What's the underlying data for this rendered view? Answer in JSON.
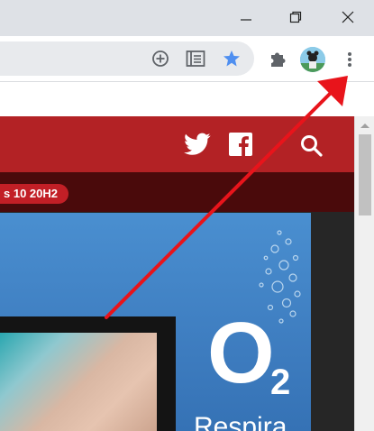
{
  "window": {
    "minimize_icon": "minimize-icon",
    "restore_icon": "restore-icon",
    "close_icon": "close-icon"
  },
  "toolbar": {
    "icons": [
      "add-circle-icon",
      "reading-list-icon",
      "star-icon",
      "puzzle-extensions-icon",
      "avatar",
      "kebab-menu-icon"
    ],
    "star_color": "#4f8ff0"
  },
  "site": {
    "header_color": "#b32225",
    "icons": [
      "twitter-icon",
      "facebook-icon",
      "search-icon"
    ],
    "tag": "s 10 20H2"
  },
  "ad": {
    "brand": "O",
    "brand_sub": "2",
    "tagline": "Respira"
  },
  "annotation": {
    "arrow_color": "#e8141b",
    "points_to": "kebab-menu-icon"
  }
}
